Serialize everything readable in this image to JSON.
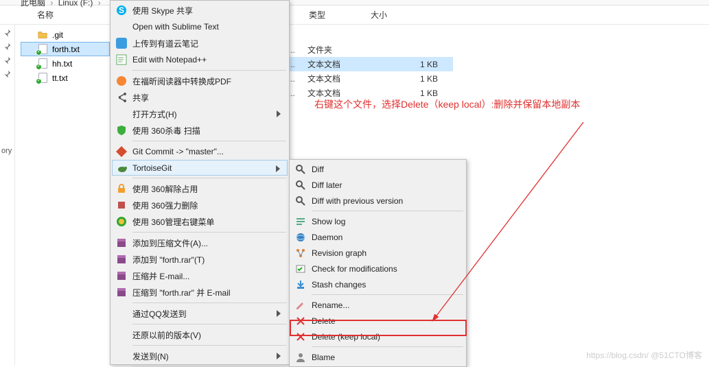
{
  "breadcrumb": {
    "loc1": "此电脑",
    "loc2": "Linux (F:)"
  },
  "columns": {
    "name": "名称",
    "type": "类型",
    "size": "大小"
  },
  "files": {
    "git": ".git",
    "forth": "forth.txt",
    "hh": "hh.txt",
    "tt": "tt.txt"
  },
  "details": {
    "folder_type": "文件夹",
    "txt_type": "文本文档",
    "size1": "1 KB",
    "size2": "1 KB",
    "size3": "1 KB"
  },
  "menu1": {
    "skype": "使用 Skype 共享",
    "sublime": "Open with Sublime Text",
    "youdao": "上传到有道云笔记",
    "notepadpp": "Edit with Notepad++",
    "foxit": "在福昕阅读器中转换成PDF",
    "share": "共享",
    "openwith": "打开方式(H)",
    "scan360": "使用 360杀毒 扫描",
    "gitcommit": "Git Commit -> \"master\"...",
    "tortoise": "TortoiseGit",
    "unzip360": "使用 360解除占用",
    "forcedel360": "使用 360强力删除",
    "rightmenu360": "使用 360管理右键菜单",
    "addarchive": "添加到压缩文件(A)...",
    "addforth": "添加到 \"forth.rar\"(T)",
    "compressemail": "压缩并 E-mail...",
    "compressforthemail": "压缩到 \"forth.rar\" 并 E-mail",
    "qqsend": "通过QQ发送到",
    "restore": "还原以前的版本(V)",
    "sendto": "发送到(N)"
  },
  "menu2": {
    "diff": "Diff",
    "difflater": "Diff later",
    "diffprev": "Diff with previous version",
    "showlog": "Show log",
    "daemon": "Daemon",
    "revgraph": "Revision graph",
    "checkmod": "Check for modifications",
    "stash": "Stash changes",
    "rename": "Rename...",
    "delete": "Delete",
    "deletekeep": "Delete (keep local)",
    "blame": "Blame"
  },
  "annotation": {
    "text": "右键这个文件，选择Delete（keep local）:删除并保留本地副本"
  },
  "sidebar": {
    "ory": "ory"
  },
  "watermark": "https://blog.csdn/ @51CTO博客"
}
